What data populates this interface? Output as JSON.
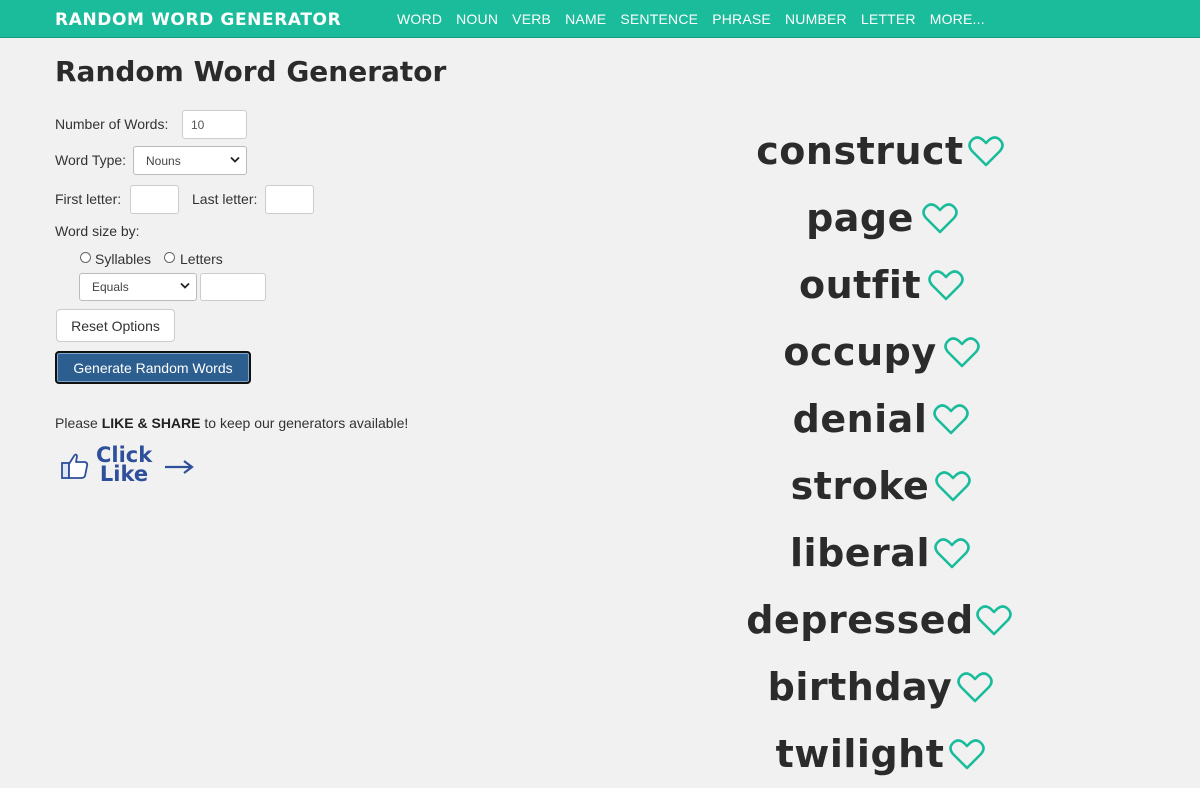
{
  "header": {
    "brand": "RANDOM WORD GENERATOR",
    "nav": [
      "WORD",
      "NOUN",
      "VERB",
      "NAME",
      "SENTENCE",
      "PHRASE",
      "NUMBER",
      "LETTER",
      "MORE..."
    ]
  },
  "page_title": "Random Word Generator",
  "form": {
    "num_words_label": "Number of Words:",
    "num_words_value": "10",
    "word_type_label": "Word Type:",
    "word_type_value": "Nouns",
    "first_letter_label": "First letter:",
    "last_letter_label": "Last letter:",
    "word_size_label": "Word size by:",
    "syllables_label": "Syllables",
    "letters_label": "Letters",
    "comparison_value": "Equals",
    "reset_label": "Reset Options",
    "generate_label": "Generate Random Words"
  },
  "share": {
    "prefix": "Please ",
    "bold": "LIKE & SHARE",
    "suffix": " to keep our generators available!",
    "click_like_line1": "Click",
    "click_like_line2": "Like"
  },
  "results": {
    "words": [
      "construct",
      "page",
      "outfit",
      "occupy",
      "denial",
      "stroke",
      "liberal",
      "depressed",
      "birthday",
      "twilight"
    ]
  },
  "colors": {
    "accent": "#1abc9c",
    "button": "#2c5e8f",
    "like_blue": "#2e4f9a"
  },
  "icons": {
    "favorite": "heart-outline-icon",
    "like": "thumbs-up-icon",
    "arrow": "arrow-right-icon",
    "select": "chevron-down-icon"
  }
}
